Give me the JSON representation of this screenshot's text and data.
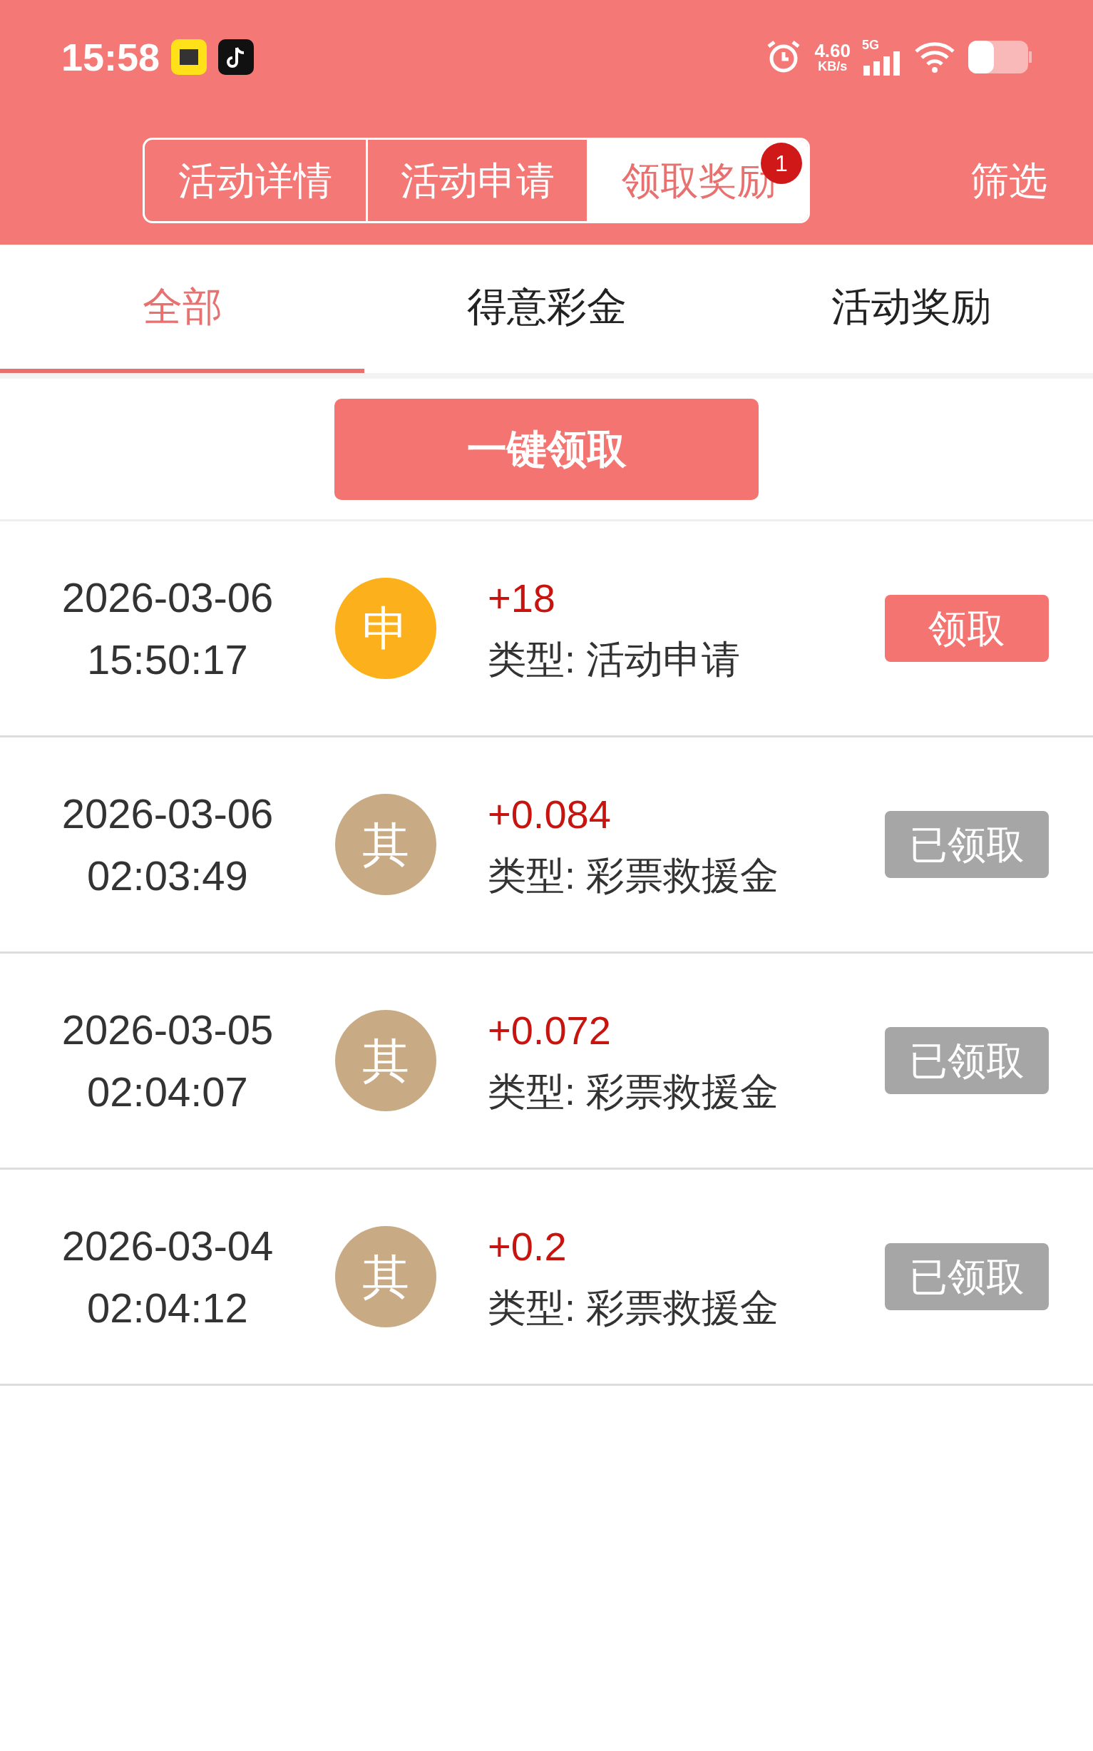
{
  "status_bar": {
    "time": "15:58",
    "speed": "4.60",
    "speed_unit": "KB/s",
    "network": "5G"
  },
  "header": {
    "tabs": [
      {
        "label": "活动详情",
        "selected": false
      },
      {
        "label": "活动申请",
        "selected": false
      },
      {
        "label": "领取奖励",
        "selected": true,
        "badge": "1"
      }
    ],
    "filter": "筛选"
  },
  "sub_tabs": [
    {
      "label": "全部",
      "selected": true
    },
    {
      "label": "得意彩金",
      "selected": false
    },
    {
      "label": "活动奖励",
      "selected": false
    }
  ],
  "claim_all_button": "一键领取",
  "records": [
    {
      "date": "2026-03-06",
      "time": "15:50:17",
      "avatar": "申",
      "color": "#fbb01c",
      "amount": "+18",
      "type": "类型: 活动申请",
      "action": "领取",
      "claimed": false
    },
    {
      "date": "2026-03-06",
      "time": "02:03:49",
      "avatar": "其",
      "color": "#c8ab85",
      "amount": "+0.084",
      "type": "类型: 彩票救援金",
      "action": "已领取",
      "claimed": true
    },
    {
      "date": "2026-03-05",
      "time": "02:04:07",
      "avatar": "其",
      "color": "#c8ab85",
      "amount": "+0.072",
      "type": "类型: 彩票救援金",
      "action": "已领取",
      "claimed": true
    },
    {
      "date": "2026-03-04",
      "time": "02:04:12",
      "avatar": "其",
      "color": "#c8ab85",
      "amount": "+0.2",
      "type": "类型: 彩票救援金",
      "action": "已领取",
      "claimed": true
    }
  ]
}
